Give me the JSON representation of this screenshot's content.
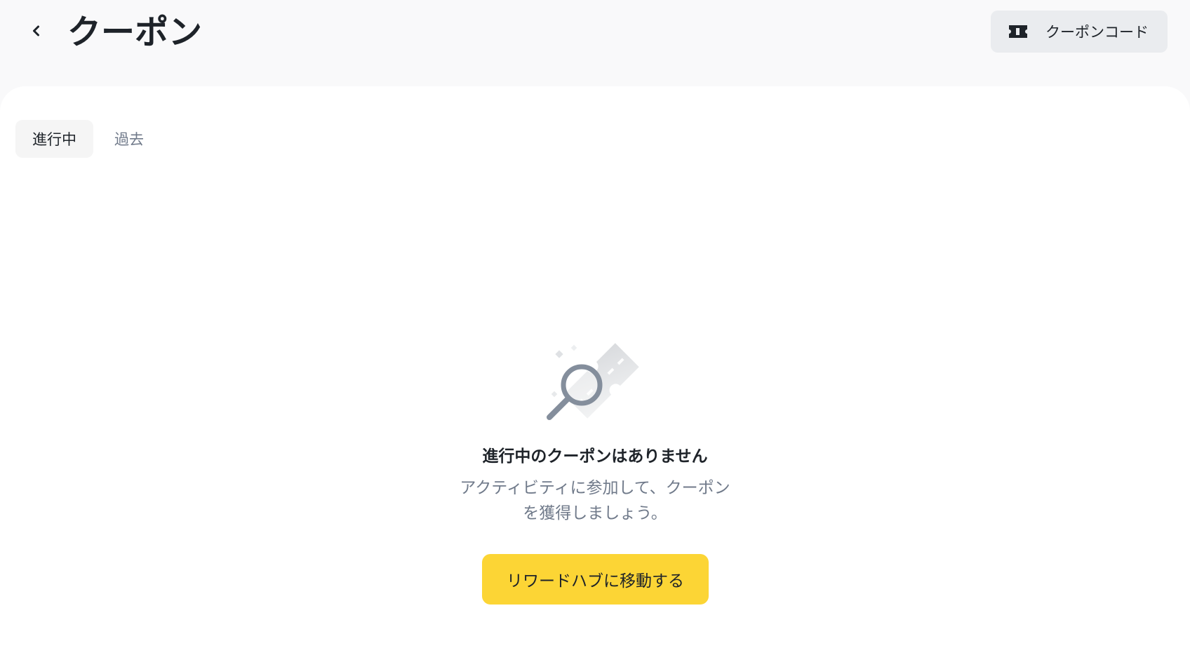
{
  "header": {
    "title": "クーポン",
    "coupon_code_label": "クーポンコード"
  },
  "tabs": [
    {
      "label": "進行中",
      "active": true
    },
    {
      "label": "過去",
      "active": false
    }
  ],
  "empty_state": {
    "title": "進行中のクーポンはありません",
    "line1": "アクティビティに参加して、クーポン",
    "line2": "を獲得しましょう。",
    "cta_label": "リワードハブに移動する"
  },
  "colors": {
    "accent": "#fcd535",
    "text_primary": "#1e2329",
    "text_secondary": "#707a8a",
    "header_bg": "#f9f9fa",
    "content_bg": "#ffffff",
    "button_gray": "#eaecef"
  },
  "icons": {
    "back": "chevron-left-icon",
    "coupon_code": "ticket-icon",
    "empty": "magnifier-coupon-illustration"
  }
}
